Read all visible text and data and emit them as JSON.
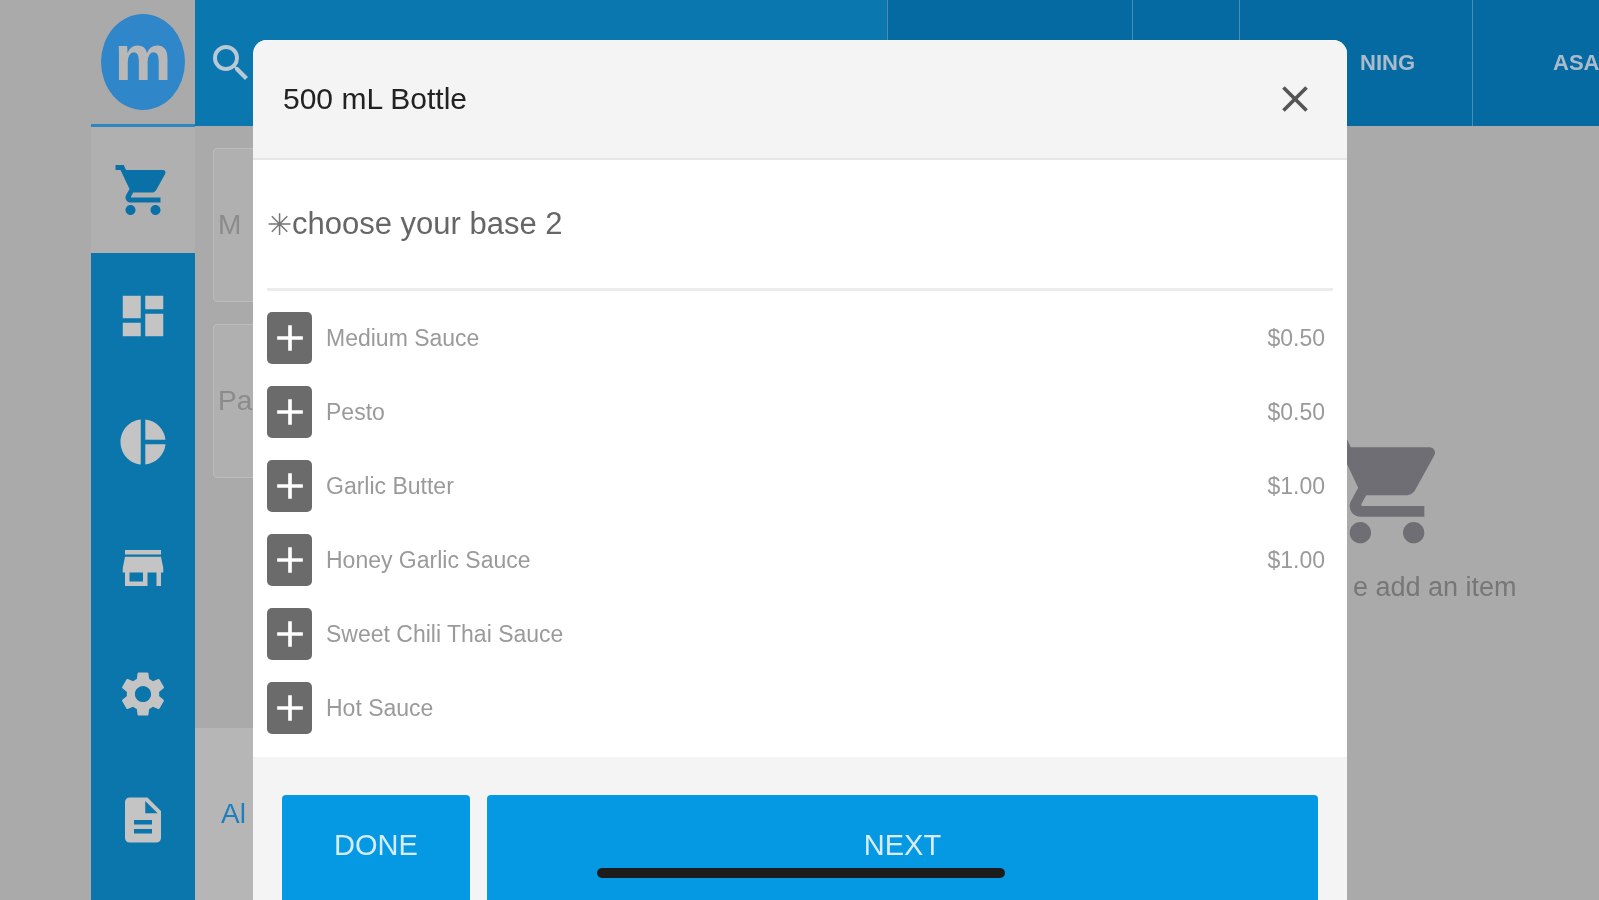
{
  "logo": {
    "text": "m"
  },
  "sidebar": {
    "items": [
      {
        "selected": true
      },
      {
        "selected": false
      },
      {
        "selected": false
      },
      {
        "selected": false
      },
      {
        "selected": false
      },
      {
        "selected": false
      }
    ]
  },
  "top_tabs": [
    {
      "label": "NING"
    },
    {
      "label": "ASA"
    }
  ],
  "background": {
    "cards": [
      {
        "text": "M"
      },
      {
        "text": "Pa"
      }
    ],
    "bottom_link": "Al",
    "empty_cart_text": "e add an item"
  },
  "modal": {
    "title": "500 mL Bottle",
    "section_title": "choose your base 2",
    "required_mark": "✳",
    "options": [
      {
        "name": "Medium Sauce",
        "price": "$0.50"
      },
      {
        "name": "Pesto",
        "price": "$0.50"
      },
      {
        "name": "Garlic Butter",
        "price": "$1.00"
      },
      {
        "name": "Honey Garlic Sauce",
        "price": "$1.00"
      },
      {
        "name": "Sweet Chili Thai Sauce"
      },
      {
        "name": "Hot Sauce"
      }
    ],
    "buttons": [
      {
        "kind": "done",
        "label": "DONE"
      },
      {
        "kind": "next",
        "label": "NEXT"
      }
    ]
  }
}
